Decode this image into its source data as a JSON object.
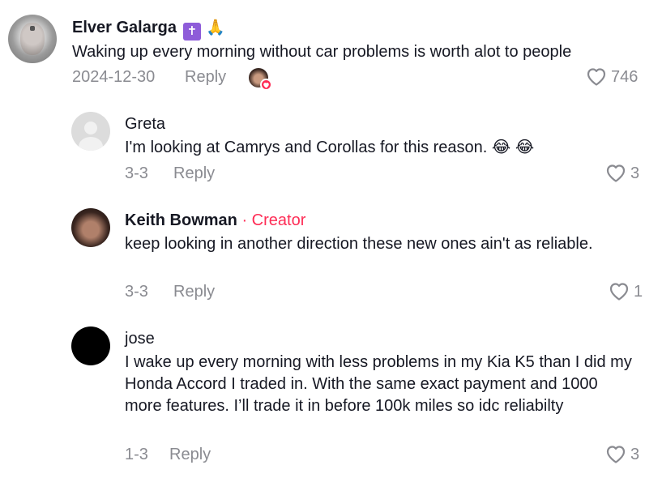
{
  "comments": [
    {
      "author": "Elver Galarga",
      "author_badges": [
        "✝️",
        "🙏"
      ],
      "text": "Waking up every morning without car problems is worth alot to people",
      "date": "2024-12-30",
      "reply_label": "Reply",
      "likes": "746",
      "liked_by_creator": true
    },
    {
      "author": "Greta",
      "text": "I'm looking at Camrys and Corollas for this reason. 😂 😂",
      "date": "3-3",
      "reply_label": "Reply",
      "likes": "3"
    },
    {
      "author": "Keith Bowman",
      "author_tag": "· Creator",
      "text": "keep looking in another direction these new ones ain't as reliable.",
      "date": "3-3",
      "reply_label": "Reply",
      "likes": "1"
    },
    {
      "author": "jose",
      "text": "I wake up every morning with less problems in my Kia K5 than I did my Honda Accord I traded in. With the same exact payment and 1000 more features. I’ll trade it in before 100k miles so idc reliabilty",
      "date": "1-3",
      "reply_label": "Reply",
      "likes": "3"
    }
  ],
  "colors": {
    "creator_accent": "#fe2c55",
    "meta_gray": "#8a8b91",
    "text": "#161823"
  }
}
